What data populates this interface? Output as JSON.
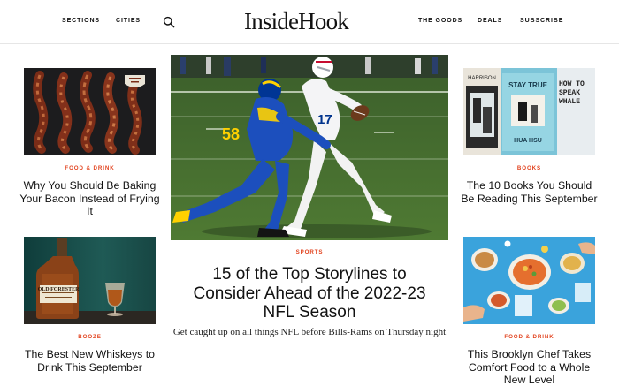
{
  "header": {
    "nav_left": [
      "SECTIONS",
      "CITIES"
    ],
    "logo": "InsideHook",
    "nav_right": [
      "THE GOODS",
      "DEALS",
      "SUBSCRIBE"
    ],
    "search_icon": "search-icon"
  },
  "articles": {
    "bacon": {
      "category": "FOOD & DRINK",
      "title": "Why You Should Be Baking Your Bacon Instead of Frying It"
    },
    "whiskey": {
      "category": "BOOZE",
      "title": "The Best New Whiskeys to Drink This September",
      "bottle_label": "OLD FORESTER"
    },
    "nfl": {
      "category": "SPORTS",
      "title": "15 of the Top Storylines to Consider Ahead of the 2022-23 NFL Season",
      "dek": "Get caught up on all things NFL before Bills-Rams on Thursday night",
      "jersey_left": "58",
      "jersey_right": "17"
    },
    "books": {
      "category": "BOOKS",
      "title": "The 10 Books You Should Be Reading This September",
      "book_texts": [
        "HARRISON",
        "STAY TRUE",
        "HUA HSU",
        "HOW TO SPEAK WHALE"
      ]
    },
    "chef": {
      "category": "FOOD & DRINK",
      "title": "This Brooklyn Chef Takes Comfort Food to a Whole New Level"
    }
  },
  "colors": {
    "accent": "#e2431f",
    "text": "#111111",
    "divider": "#e6e6e6"
  }
}
